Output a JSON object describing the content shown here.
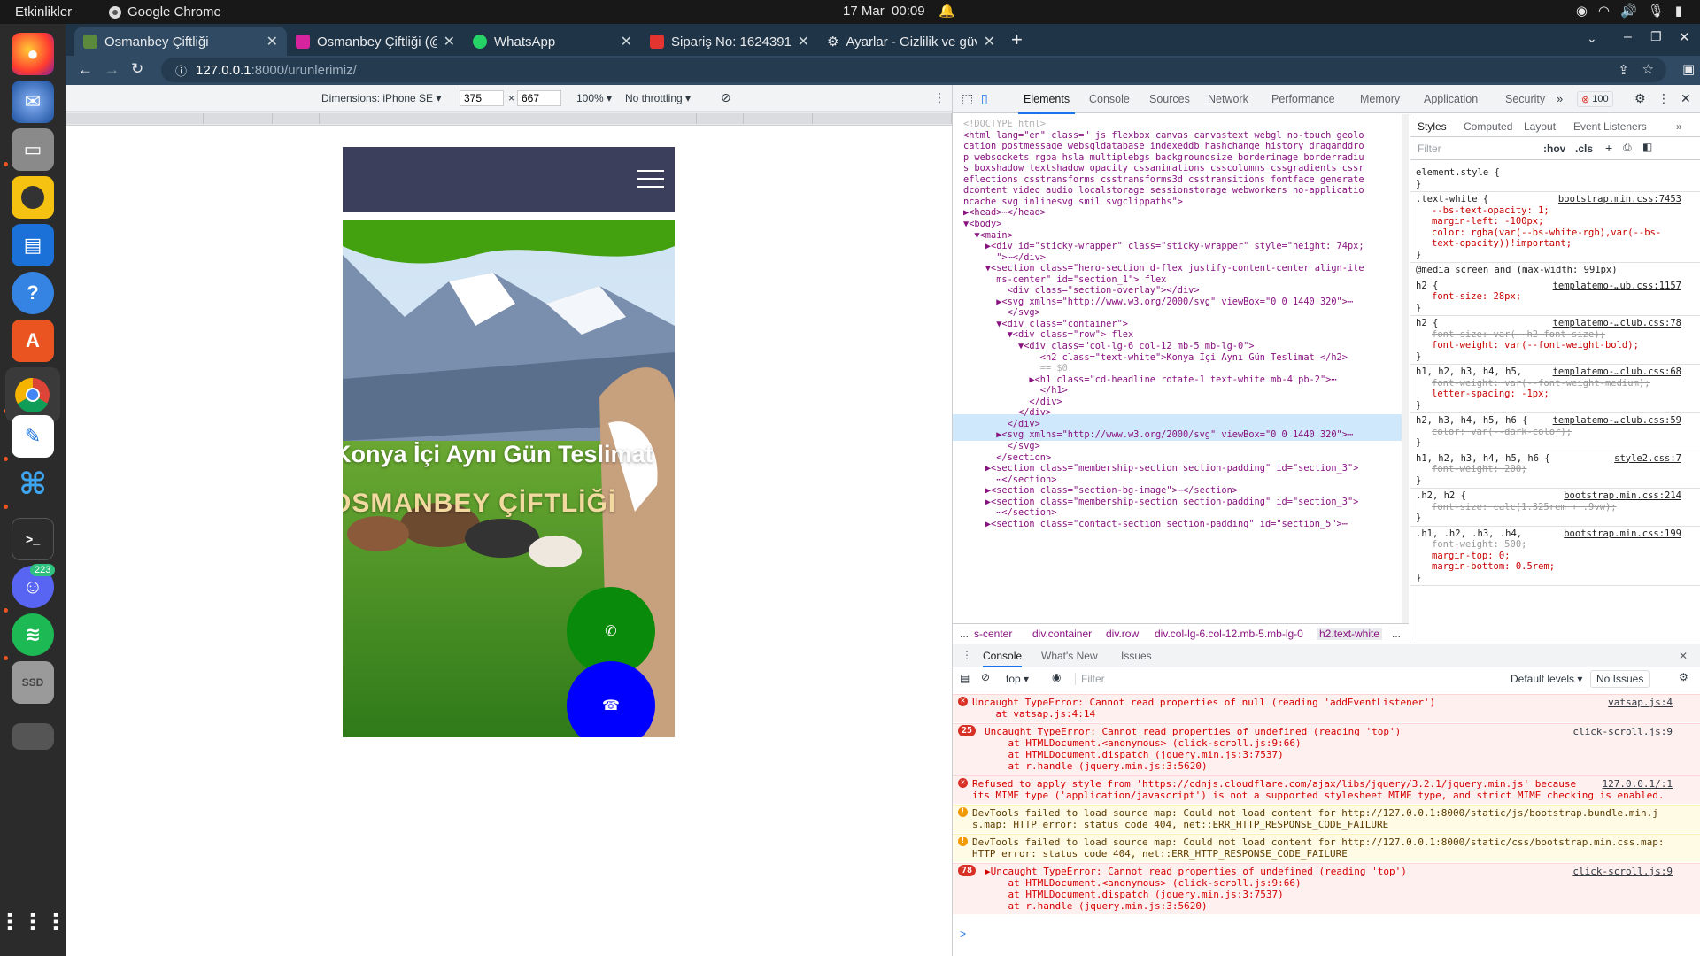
{
  "topbar": {
    "activities": "Etkinlikler",
    "app_name": "Google Chrome",
    "clock_date": "17 Mar",
    "clock_time": "00:09"
  },
  "dock": {
    "items": [
      "firefox-icon",
      "thunderbird-icon",
      "files-icon",
      "rhythmbox-icon",
      "libreoffice-writer-icon",
      "help-icon",
      "app-center-icon",
      "chrome-icon",
      "text-editor-icon",
      "vscode-icon",
      "terminal-icon",
      "discord-icon",
      "spotify-icon",
      "ssd-drive-icon",
      "drive-icon",
      "show-apps-icon"
    ],
    "discord_badge": "223",
    "ssd_label": "SSD"
  },
  "tabs": [
    {
      "title": "Osmanbey Çiftliği",
      "favicon_color": "#5b8a3c",
      "active": true
    },
    {
      "title": "Osmanbey Çiftliği (@osm",
      "favicon_color": "#d6249f",
      "active": false
    },
    {
      "title": "WhatsApp",
      "favicon_color": "#25d366",
      "active": false
    },
    {
      "title": "Sipariş No: 1624391 | Bion",
      "favicon_color": "#e3342f",
      "active": false
    },
    {
      "title": "Ayarlar - Gizlilik ve güvenl",
      "favicon_color": "#9aa0a6",
      "active": false
    }
  ],
  "omnibox": {
    "host": "127.0.0.1",
    "path": ":8000/urunlerimiz/"
  },
  "profile_initial": "N",
  "device_toolbar": {
    "dimensions": "Dimensions: iPhone SE",
    "width": "375",
    "height": "667",
    "zoom": "100%",
    "throttling": "No throttling"
  },
  "page": {
    "hero_title": "Konya İçi Aynı Gün Teslimat",
    "hero_headline": "OSMANBEY ÇİFTLİĞİ",
    "nav_color": "#3b3f5c",
    "whatsapp_color": "#0a8a0a",
    "phone_color": "#0000ff"
  },
  "devtools": {
    "tabs": [
      "Elements",
      "Console",
      "Sources",
      "Network",
      "Performance",
      "Memory",
      "Application",
      "Security"
    ],
    "error_count": "100",
    "styles_tabs": [
      "Styles",
      "Computed",
      "Layout",
      "Event Listeners"
    ],
    "styles_filter": "Filter",
    "hov": ":hov",
    "cls": ".cls",
    "breadcrumbs": [
      "...",
      "s-center",
      "div.container",
      "div.row",
      "div.col-lg-6.col-12.mb-5.mb-lg-0",
      "h2.text-white",
      "..."
    ],
    "dom_lines": [
      "<!DOCTYPE html>",
      "<html lang=\"en\" class=\" js flexbox canvas canvastext webgl no-touch geolo",
      "cation postmessage websqldatabase indexeddb hashchange history draganddro",
      "p websockets rgba hsla multiplebgs backgroundsize borderimage borderradiu",
      "s boxshadow textshadow opacity cssanimations csscolumns cssgradients cssr",
      "eflections csstransforms csstransforms3d csstransitions fontface generate",
      "dcontent video audio localstorage sessionstorage webworkers no-applicatio",
      "ncache svg inlinesvg smil svgclippaths\">",
      "▶<head>⋯</head>",
      "▼<body>",
      "  ▼<main>",
      "    ▶<div id=\"sticky-wrapper\" class=\"sticky-wrapper\" style=\"height: 74px;",
      "      \">⋯</div>",
      "    ▼<section class=\"hero-section d-flex justify-content-center align-ite",
      "      ms-center\" id=\"section_1\"> flex",
      "        <div class=\"section-overlay\"></div>",
      "      ▶<svg xmlns=\"http://www.w3.org/2000/svg\" viewBox=\"0 0 1440 320\">⋯",
      "        </svg>",
      "      ▼<div class=\"container\">",
      "        ▼<div class=\"row\"> flex",
      "          ▼<div class=\"col-lg-6 col-12 mb-5 mb-lg-0\">",
      "              <h2 class=\"text-white\">Konya İçi Aynı Gün Teslimat </h2>",
      "              == $0",
      "            ▶<h1 class=\"cd-headline rotate-1 text-white mb-4 pb-2\">⋯",
      "              </h1>",
      "            </div>",
      "          </div>",
      "        </div>",
      "      ▶<svg xmlns=\"http://www.w3.org/2000/svg\" viewBox=\"0 0 1440 320\">⋯",
      "        </svg>",
      "      </section>",
      "    ▶<section class=\"membership-section section-padding\" id=\"section_3\">",
      "      ⋯</section>",
      "    ▶<section class=\"section-bg-image\">⋯</section>",
      "    ▶<section class=\"membership-section section-padding\" id=\"section_3\">",
      "      ⋯</section>",
      "    ▶<section class=\"contact-section section-padding\" id=\"section_5\">⋯"
    ],
    "style_rules": [
      {
        "sel": "element.style {",
        "src": "",
        "props": [],
        "struck": []
      },
      {
        "sel": ".text-white {",
        "src": "bootstrap.min.css:7453",
        "props": [
          "--bs-text-opacity: 1;",
          "margin-left: -100px;",
          "color: rgba(var(--bs-white-rgb),var(--bs-",
          "  text-opacity))!important;"
        ],
        "struck": []
      },
      {
        "sel": "@media screen and (max-width: 991px)",
        "src": "",
        "props": [],
        "struck": []
      },
      {
        "sel": "h2 {",
        "src": "templatemo-…ub.css:1157",
        "props": [
          "font-size: 28px;"
        ],
        "struck": []
      },
      {
        "sel": "h2 {",
        "src": "templatemo-…club.css:78",
        "props": [
          "font-weight: var(--font-weight-bold);"
        ],
        "struck": [
          "font-size: var(--h2-font-size);"
        ]
      },
      {
        "sel": "h1, h2, h3, h4, h5,",
        "src": "templatemo-…club.css:68",
        "props": [
          "letter-spacing: -1px;"
        ],
        "struck": [
          "font-weight: var(--font-weight-medium);"
        ]
      },
      {
        "sel": "h2, h3, h4, h5, h6 {",
        "src": "templatemo-…club.css:59",
        "props": [],
        "struck": [
          "color: var(--dark-color);"
        ]
      },
      {
        "sel": "h1, h2, h3, h4, h5, h6 {",
        "src": "style2.css:7",
        "props": [],
        "struck": [
          "font-weight: 200;"
        ]
      },
      {
        "sel": ".h2, h2 {",
        "src": "bootstrap.min.css:214",
        "props": [],
        "struck": [
          "font-size: calc(1.325rem + .9vw);"
        ]
      },
      {
        "sel": ".h1, .h2, .h3, .h4,",
        "src": "bootstrap.min.css:199",
        "props": [
          "margin-top: 0;",
          "margin-bottom: 0.5rem;"
        ],
        "struck": [
          "font-weight: 500;"
        ]
      }
    ],
    "console": {
      "tabs": [
        "Console",
        "What's New",
        "Issues"
      ],
      "context": "top",
      "filter_placeholder": "Filter",
      "levels": "Default levels",
      "issues": "No Issues",
      "messages": [
        {
          "type": "err",
          "count": "",
          "lines": [
            "Uncaught TypeError: Cannot read properties of null (reading 'addEventListener')",
            "    at vatsap.js:4:14"
          ],
          "src": "vatsap.js:4"
        },
        {
          "type": "err",
          "count": "25",
          "lines": [
            "Uncaught TypeError: Cannot read properties of undefined (reading 'top')",
            "    at HTMLDocument.<anonymous> (click-scroll.js:9:66)",
            "    at HTMLDocument.dispatch (jquery.min.js:3:7537)",
            "    at r.handle (jquery.min.js:3:5620)"
          ],
          "src": "click-scroll.js:9"
        },
        {
          "type": "err",
          "count": "",
          "lines": [
            "Refused to apply style from 'https://cdnjs.cloudflare.com/ajax/libs/jquery/3.2.1/jquery.min.js' because",
            "its MIME type ('application/javascript') is not a supported stylesheet MIME type, and strict MIME checking is enabled."
          ],
          "src": "127.0.0.1/:1"
        },
        {
          "type": "warn",
          "count": "",
          "lines": [
            "DevTools failed to load source map: Could not load content for http://127.0.0.1:8000/static/js/bootstrap.bundle.min.j",
            "s.map: HTTP error: status code 404, net::ERR_HTTP_RESPONSE_CODE_FAILURE"
          ],
          "src": ""
        },
        {
          "type": "warn",
          "count": "",
          "lines": [
            "DevTools failed to load source map: Could not load content for http://127.0.0.1:8000/static/css/bootstrap.min.css.map:",
            "HTTP error: status code 404, net::ERR_HTTP_RESPONSE_CODE_FAILURE"
          ],
          "src": ""
        },
        {
          "type": "err",
          "count": "78",
          "lines": [
            "▶Uncaught TypeError: Cannot read properties of undefined (reading 'top')",
            "    at HTMLDocument.<anonymous> (click-scroll.js:9:66)",
            "    at HTMLDocument.dispatch (jquery.min.js:3:7537)",
            "    at r.handle (jquery.min.js:3:5620)"
          ],
          "src": "click-scroll.js:9"
        }
      ],
      "prompt": ">"
    }
  }
}
